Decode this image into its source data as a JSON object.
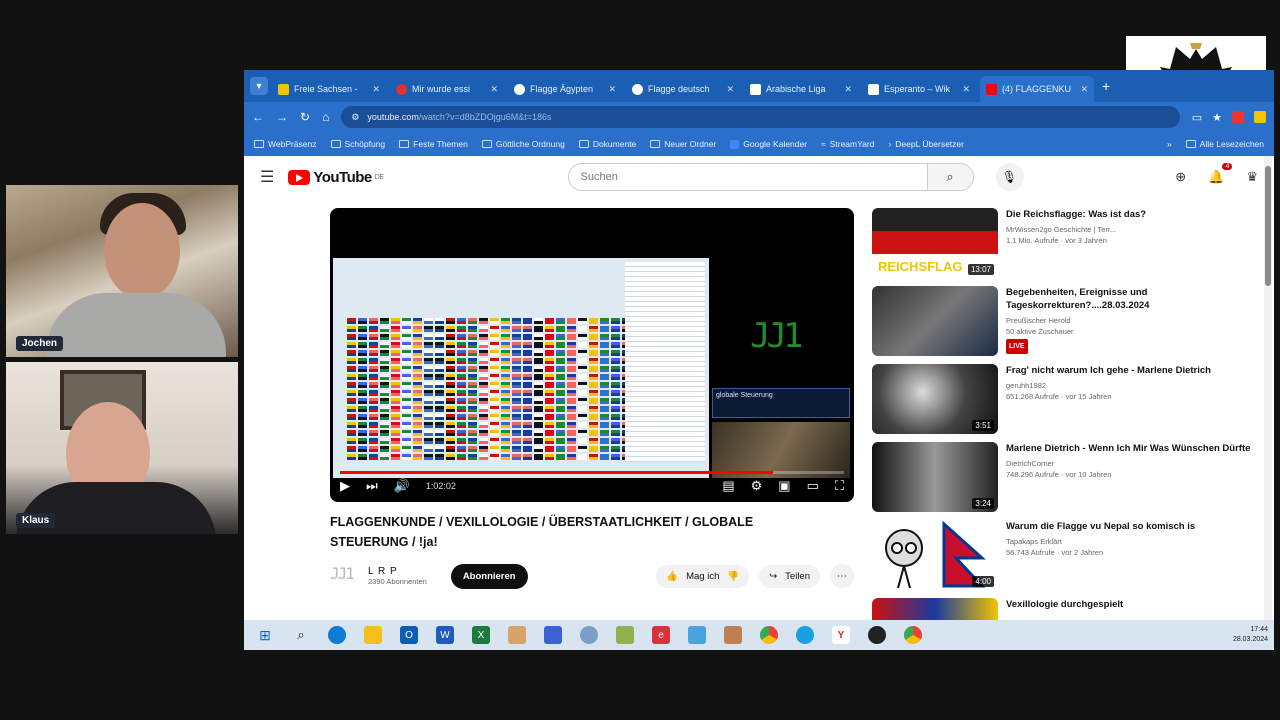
{
  "participants": [
    {
      "name": "Jochen"
    },
    {
      "name": "Klaus"
    }
  ],
  "browser": {
    "tabs": [
      {
        "title": "Freie Sachsen -",
        "favicon_color": "#f0c400",
        "active": false
      },
      {
        "title": "Mir wurde essi",
        "favicon_color": "#d33",
        "active": false
      },
      {
        "title": "Flagge Ägypten",
        "favicon_color": "#fff",
        "active": false
      },
      {
        "title": "Flagge deutsch",
        "favicon_color": "#fff",
        "active": false
      },
      {
        "title": "Arabische Liga",
        "favicon_color": "#fff",
        "active": false
      },
      {
        "title": "Esperanto – Wik",
        "favicon_color": "#fff",
        "active": false
      },
      {
        "title": "(4) FLAGGENKU",
        "favicon_color": "#ff0000",
        "active": true
      }
    ],
    "url_host": "youtube.com",
    "url_rest": "/watch?v=d8bZDOjgu6M&t=186s",
    "bookmarks": [
      "WebPräsenz",
      "Schöpfung",
      "Feste Themen",
      "Göttliche Ordnung",
      "Dokumente",
      "Neuer Ordner",
      "Google Kalender",
      "StreamYard",
      "DeepL Übersetzer"
    ],
    "bookmarks_all": "Alle Lesezeichen"
  },
  "youtube": {
    "logo_text": "YouTube",
    "logo_region": "DE",
    "search_placeholder": "Suchen",
    "notifications_count": "4",
    "video": {
      "title": "FLAGGENKUNDE / VEXILLOLOGIE / ÜBERSTAATLICHKEIT / GLOBALE STEUERUNG / !ja!",
      "side_logo": "ЈЈ1",
      "mini_window_text": "globale Steuerung",
      "time": "1:02:02",
      "progress": 0.86
    },
    "channel": {
      "name": "L R P",
      "subs": "2390 Abonnenten",
      "avatar": "ЈЈ1"
    },
    "subscribe_label": "Abonnieren",
    "like_label": "Mag ich",
    "share_label": "Teilen",
    "recommendations": [
      {
        "title": "Die Reichsflagge: Was ist das?",
        "channel": "MrWissen2go Geschichte | Terr...",
        "meta": "1,1 Mio. Aufrufe · vor 3 Jahren",
        "duration": "13:07",
        "thumb_text": "REICHSFLAG",
        "live": false
      },
      {
        "title": "Begebenheiten, Ereignisse und Tageskorrekturen?....28.03.2024",
        "channel": "Preußischer Herold",
        "meta": "50 aktive Zuschauer",
        "duration": "",
        "thumb_text": "",
        "live": true,
        "live_label": "LIVE"
      },
      {
        "title": "Frag' nicht warum Ich gehe - Marlene Dietrich",
        "channel": "geruhh1982",
        "meta": "651.268 Aufrufe · vor 15 Jahren",
        "duration": "3:51",
        "thumb_text": "",
        "live": false
      },
      {
        "title": "Marlene Dietrich - Wenn Ich Mir Was Wünschen Dürfte",
        "channel": "DietrichCorner",
        "meta": "748.296 Aufrufe · vor 10 Jahren",
        "duration": "3:24",
        "thumb_text": "",
        "live": false
      },
      {
        "title": "Warum die Flagge vu Nepal so komisch is",
        "channel": "Tapakaps Erklärt",
        "meta": "56.743 Aufrufe · vor 2 Jahren",
        "duration": "4:00",
        "thumb_text": "",
        "live": false
      },
      {
        "title": "Vexillologie durchgespielt",
        "channel": "",
        "meta": "",
        "duration": "",
        "thumb_text": "",
        "live": false
      }
    ]
  },
  "taskbar": {
    "time": "17:44",
    "date": "28.03.2024"
  }
}
